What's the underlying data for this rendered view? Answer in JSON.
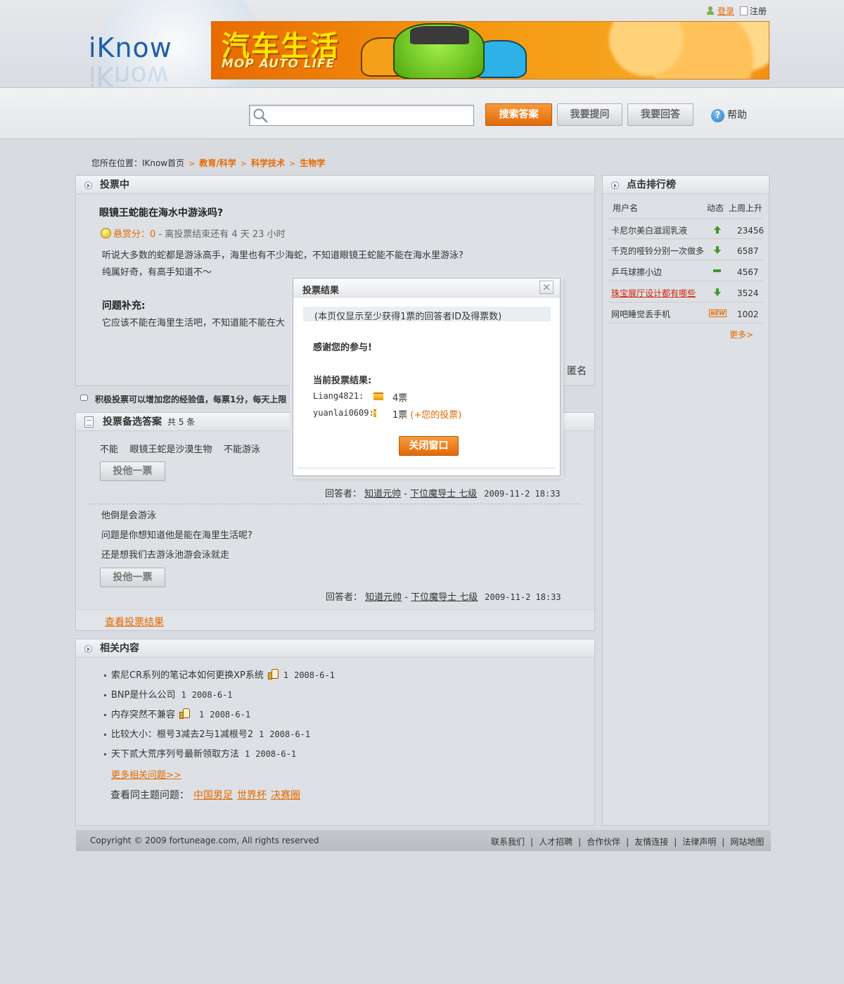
{
  "header": {
    "logo": "iKnow",
    "banner_title": "汽车生活",
    "banner_subtitle": "MOP AUTO LIFE",
    "login_label": "登录",
    "register_label": "注册"
  },
  "search": {
    "placeholder": "",
    "search_button": "搜索答案",
    "ask_button": "我要提问",
    "answer_button": "我要回答",
    "help_label": "帮助",
    "help_glyph": "?"
  },
  "breadcrumb": {
    "prefix": "您所在位置：",
    "home": "IKnow首页",
    "items": [
      "教育/科学",
      "科学技术",
      "生物学"
    ],
    "sep": ">"
  },
  "voting": {
    "header": "投票中",
    "question_title": "眼镜王蛇能在海水中游泳吗?",
    "reward_label": "悬赏分：",
    "reward_value": "0",
    "remaining": " - 离投票结束还有 4 天 23 小时",
    "body_line1": "听说大多数的蛇都是游泳高手，海里也有不少海蛇，不知道眼镜王蛇能不能在海水里游泳?",
    "body_line2": "纯属好奇，有高手知道不～",
    "supplement_title": "问题补充:",
    "supplement_body": "它应该不能在海里生活吧，不知道能不能在大",
    "asker": "匿名"
  },
  "tip": {
    "text": "积极投票可以增加您的经验值，每票1分，每天上限"
  },
  "answers": {
    "header": "投票备选答案",
    "count_label": "共 5 条",
    "vote_button": "投他一票",
    "answerer_label": "回答者：",
    "items": [
      {
        "lines": [
          "不能    眼镜王蛇是沙漠生物    不能游泳"
        ],
        "user": "知道元帅",
        "rank": "下位魔导士 七级",
        "date": "2009-11-2 18:33"
      },
      {
        "lines": [
          "他倒是会游泳",
          "问题是你想知道他是能在海里生活呢?",
          "还是想我们去游泳池游会泳就走"
        ],
        "user": "知道元帅",
        "rank": "下位魔导士 七级",
        "date": "2009-11-2 18:33"
      }
    ],
    "view_results": "查看投票结果"
  },
  "related": {
    "header": "相关内容",
    "items": [
      {
        "title": "索尼CR系列的笔记本如何更换XP系统",
        "count": "1",
        "date": "2008-6-1"
      },
      {
        "title": "BNP是什么公司",
        "count": "1",
        "date": "2008-6-1"
      },
      {
        "title": "内存突然不兼容",
        "count": "1",
        "date": "2008-6-1"
      },
      {
        "title": "比较大小：根号3减去2与1减根号2",
        "count": "1",
        "date": "2008-6-1"
      },
      {
        "title": "天下贰大荒序列号最新领取方法",
        "count": "1",
        "date": "2008-6-1"
      }
    ],
    "more": "更多相关问题>>",
    "same_topic_label": "查看同主题问题：",
    "topics": [
      "中国男足",
      "世界杯",
      "决赛圈"
    ]
  },
  "ranking": {
    "header": "点击排行榜",
    "col_user": "用户名",
    "col_trend": "动态",
    "col_score": "上周上升",
    "rows": [
      {
        "name": "卡尼尔美白滋润乳液",
        "trend": "up",
        "score": "23456"
      },
      {
        "name": "千克的哑铃分别一次做多",
        "trend": "down",
        "score": "6587"
      },
      {
        "name": "乒乓球擦小边",
        "trend": "flat",
        "score": "4567"
      },
      {
        "name": "珠宝展厅设计都有哪些",
        "trend": "down",
        "score": "3524"
      },
      {
        "name": "网吧睡觉丢手机",
        "trend": "new",
        "score": "1002"
      }
    ],
    "new_badge": "NEW",
    "more": "更多>"
  },
  "footer": {
    "copyright": "Copyright © 2009 fortuneage.com, All rights reserved",
    "links": [
      "联系我们",
      "人才招聘",
      "合作伙伴",
      "友情连接",
      "法律声明",
      "网站地图"
    ],
    "sep": "|"
  },
  "modal": {
    "title": "投票结果",
    "close_glyph": "×",
    "note": "(本页仅显示至少获得1票的回答者ID及得票数)",
    "thanks": "感谢您的参与!",
    "current_label": "当前投票结果:",
    "results": [
      {
        "user": "Liang4821:",
        "votes": "4票",
        "share": 0.8
      },
      {
        "user": "yuanlai0609:",
        "votes": "1票",
        "share": 0.2
      }
    ],
    "your_vote": "(+您的投票)",
    "close_button": "关闭窗口"
  },
  "colors": {
    "accent_orange": "#e66a00",
    "trend_green": "#3c9a2a"
  }
}
